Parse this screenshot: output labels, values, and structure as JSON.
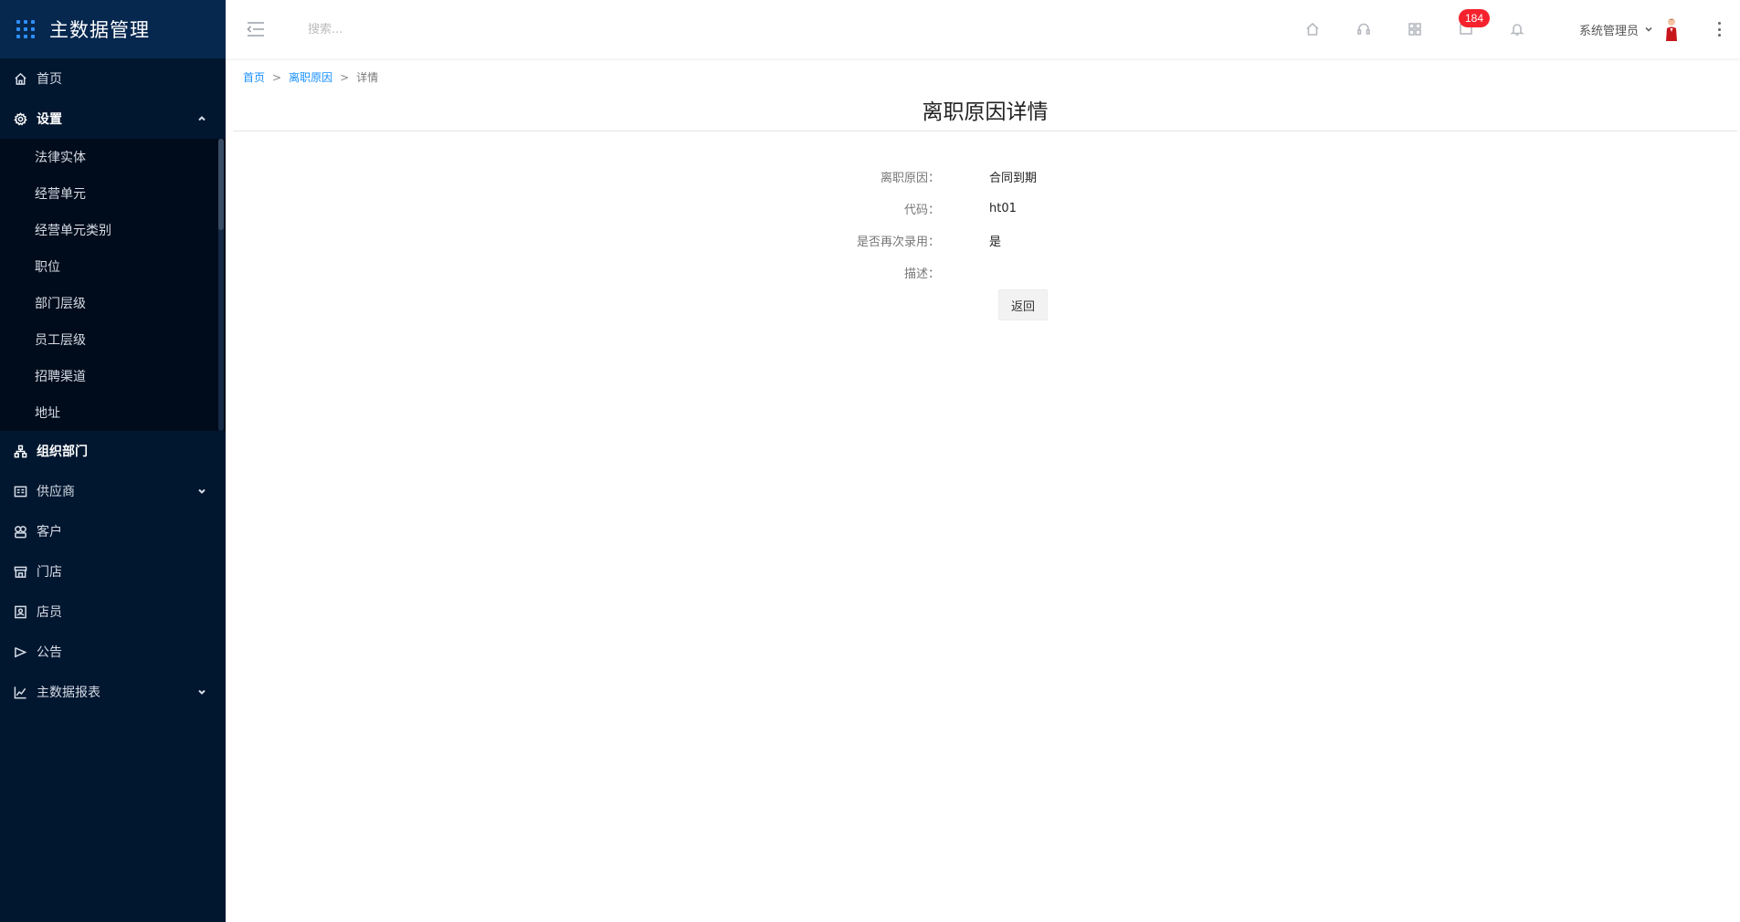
{
  "app": {
    "title": "主数据管理"
  },
  "sidebar": {
    "items": [
      {
        "label": "首页",
        "icon": "home-icon"
      },
      {
        "label": "设置",
        "icon": "gear-icon",
        "expanded": true
      },
      {
        "label": "组织部门",
        "icon": "org-chart-icon"
      },
      {
        "label": "供应商",
        "icon": "supplier-icon",
        "has_children": true
      },
      {
        "label": "客户",
        "icon": "customer-icon"
      },
      {
        "label": "门店",
        "icon": "store-icon"
      },
      {
        "label": "店员",
        "icon": "clerk-icon"
      },
      {
        "label": "公告",
        "icon": "announcement-icon"
      },
      {
        "label": "主数据报表",
        "icon": "chart-icon",
        "has_children": true
      }
    ],
    "settings_children": [
      "法律实体",
      "经营单元",
      "经营单元类别",
      "职位",
      "部门层级",
      "员工层级",
      "招聘渠道",
      "地址"
    ]
  },
  "header": {
    "search_placeholder": "搜索...",
    "notification_count": "184",
    "user_name": "系统管理员"
  },
  "breadcrumb": {
    "home": "首页",
    "parent": "离职原因",
    "current": "详情",
    "separator": ">"
  },
  "page": {
    "title": "离职原因详情",
    "fields": [
      {
        "label": "离职原因：",
        "value": "合同到期"
      },
      {
        "label": "代码：",
        "value": "ht01"
      },
      {
        "label": "是否再次录用：",
        "value": "是"
      },
      {
        "label": "描述：",
        "value": ""
      }
    ],
    "back_label": "返回"
  },
  "colors": {
    "sidebar_bg": "#01162f",
    "logo_bg": "#06284f",
    "submenu_bg": "#000c1b",
    "accent": "#1890ff",
    "badge": "#f5222d"
  }
}
